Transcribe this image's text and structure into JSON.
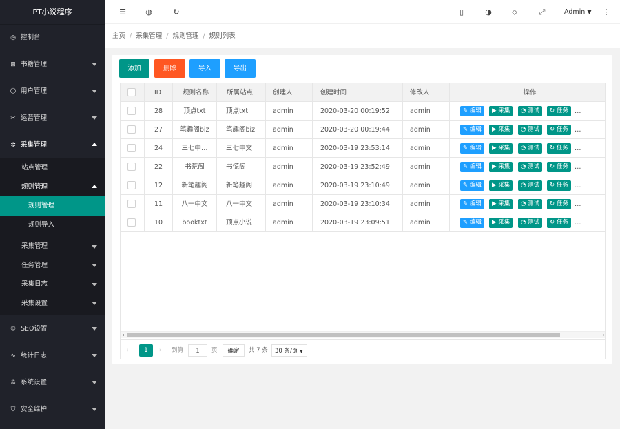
{
  "app": {
    "title": "PT小说程序"
  },
  "sidebar": {
    "items": [
      {
        "label": "控制台",
        "icon": "dashboard-icon"
      },
      {
        "label": "书籍管理",
        "icon": "book-icon"
      },
      {
        "label": "用户管理",
        "icon": "user-icon"
      },
      {
        "label": "运营管理",
        "icon": "operation-icon"
      },
      {
        "label": "采集管理",
        "icon": "gear-icon"
      },
      {
        "label": "SEO设置",
        "icon": "seo-icon"
      },
      {
        "label": "统计日志",
        "icon": "stats-icon"
      },
      {
        "label": "系统设置",
        "icon": "settings-icon"
      },
      {
        "label": "安全维护",
        "icon": "shield-icon"
      }
    ],
    "collect_sub": [
      "站点管理",
      "规则管理",
      "采集管理",
      "任务管理",
      "采集日志",
      "采集设置"
    ],
    "rule_sub": [
      "规则管理",
      "规则导入"
    ]
  },
  "topbar": {
    "user": "Admin"
  },
  "breadcrumb": [
    "主页",
    "采集管理",
    "规则管理",
    "规则列表"
  ],
  "toolbar": {
    "add": "添加",
    "delete": "删除",
    "import": "导入",
    "export": "导出"
  },
  "colors": {
    "primary": "#009688",
    "danger": "#ff5722",
    "info": "#1e9fff",
    "sidebar": "#20222a"
  },
  "table": {
    "headers": [
      "ID",
      "规则名称",
      "所属站点",
      "创建人",
      "创建时间",
      "修改人",
      "操作"
    ],
    "rows": [
      {
        "id": "28",
        "name": "顶点txt",
        "site": "顶点txt",
        "creator": "admin",
        "time": "2020-03-20 00:19:52",
        "modifier": "admin"
      },
      {
        "id": "27",
        "name": "笔趣阁biz",
        "site": "笔趣阁biz",
        "creator": "admin",
        "time": "2020-03-20 00:19:44",
        "modifier": "admin"
      },
      {
        "id": "24",
        "name": "三七中…",
        "site": "三七中文",
        "creator": "admin",
        "time": "2020-03-19 23:53:14",
        "modifier": "admin"
      },
      {
        "id": "22",
        "name": "书荒阁",
        "site": "书慌阁",
        "creator": "admin",
        "time": "2020-03-19 23:52:49",
        "modifier": "admin"
      },
      {
        "id": "12",
        "name": "新笔趣阁",
        "site": "新笔趣阁",
        "creator": "admin",
        "time": "2020-03-19 23:10:49",
        "modifier": "admin"
      },
      {
        "id": "11",
        "name": "八一中文",
        "site": "八一中文",
        "creator": "admin",
        "time": "2020-03-19 23:10:34",
        "modifier": "admin"
      },
      {
        "id": "10",
        "name": "booktxt",
        "site": "顶点小说",
        "creator": "admin",
        "time": "2020-03-19 23:09:51",
        "modifier": "admin"
      }
    ],
    "actions": [
      "编辑",
      "采集",
      "测试",
      "任务"
    ],
    "more": "…"
  },
  "pagination": {
    "current": "1",
    "goto": "到第",
    "page_input": "1",
    "page_unit": "页",
    "confirm": "确定",
    "total": "共 7 条",
    "page_size": "30 条/页"
  }
}
